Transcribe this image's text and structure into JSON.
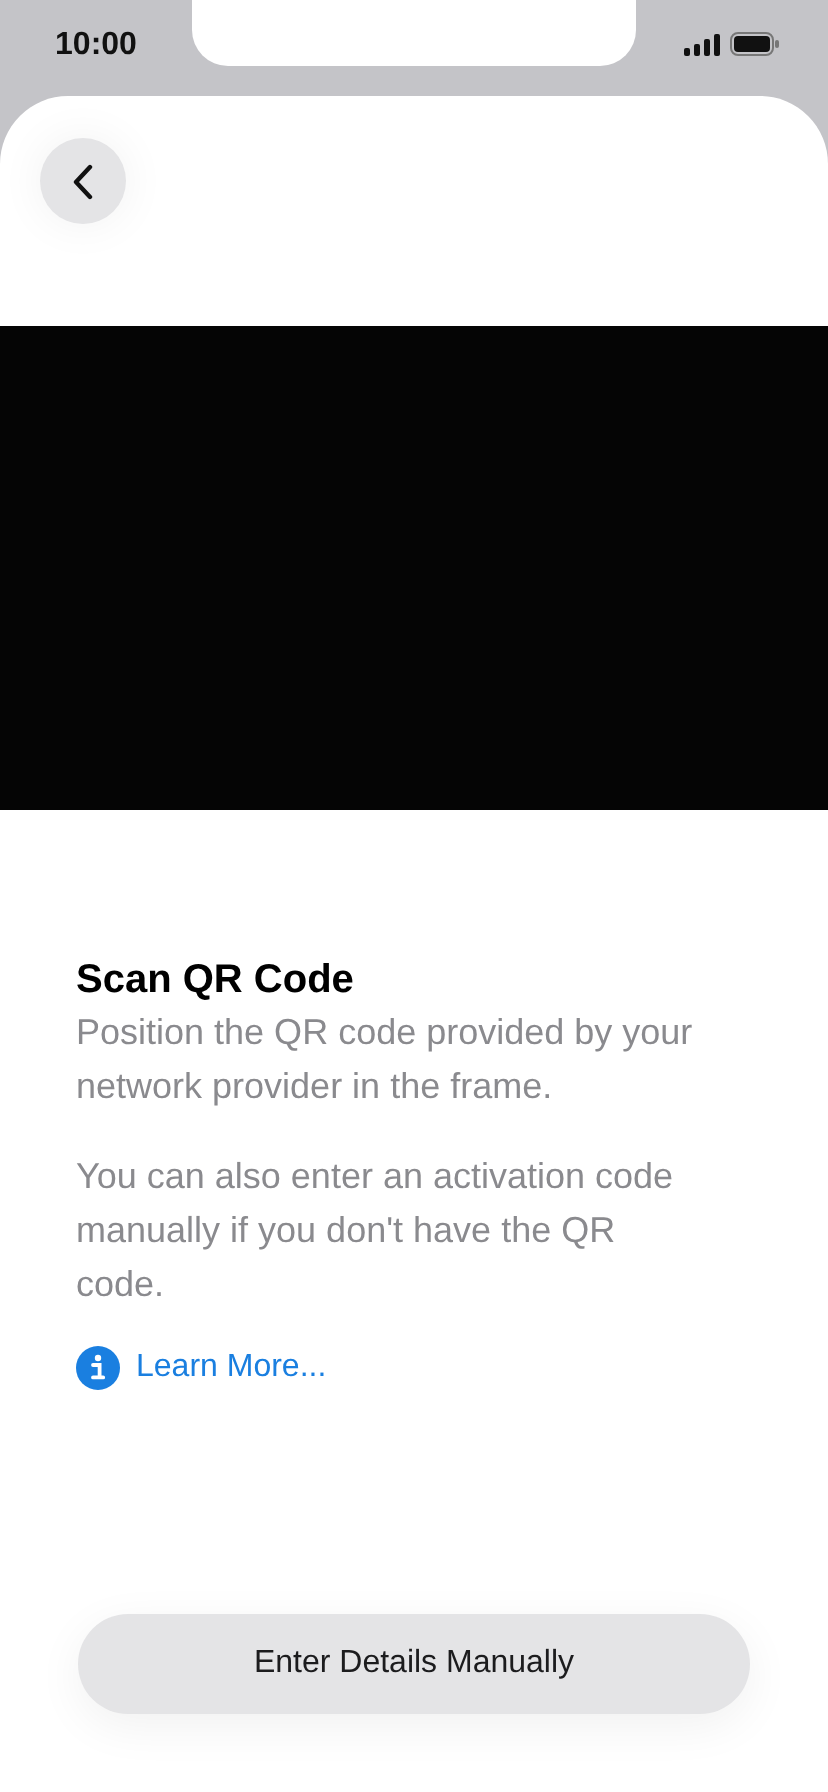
{
  "status_bar": {
    "time": "10:00"
  },
  "camera": {
    "kind": "viewfinder"
  },
  "title": "Scan QR Code",
  "paragraphs": [
    "Position the QR code provided by your network provider in the frame.",
    "You can also enter an activation code manually if you don't have the QR code."
  ],
  "learn_more": "Learn More...",
  "button": "Enter Details Manually"
}
